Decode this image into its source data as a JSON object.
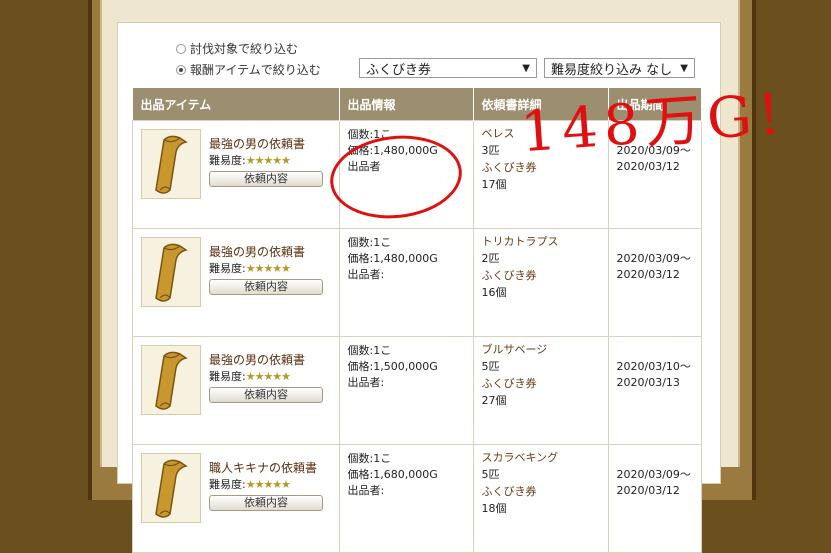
{
  "filters": {
    "radio_options": [
      {
        "label": "討伐対象で絞り込む",
        "checked": false
      },
      {
        "label": "報酬アイテムで絞り込む",
        "checked": true
      }
    ],
    "select_item": "ふくびき券",
    "select_difficulty": "難易度絞り込み なし"
  },
  "table": {
    "headers": [
      "出品アイテム",
      "出品情報",
      "依頼書詳細",
      "出品期間"
    ],
    "detail_button": "依頼内容",
    "difficulty_label": "難易度:",
    "stars": "★★★★★",
    "rows": [
      {
        "item_name": "最強の男の依頼書",
        "info": [
          "個数:1こ",
          "価格:1,480,000G",
          "出品者"
        ],
        "req": {
          "monster": "ベレス",
          "count": "3匹",
          "reward": "ふくびき券",
          "reward_count": "17個"
        },
        "dates": [
          "2020/03/09～",
          "2020/03/12"
        ]
      },
      {
        "item_name": "最強の男の依頼書",
        "info": [
          "個数:1こ",
          "価格:1,480,000G",
          "出品者:"
        ],
        "req": {
          "monster": "トリカトラプス",
          "count": "2匹",
          "reward": "ふくびき券",
          "reward_count": "16個"
        },
        "dates": [
          "2020/03/09～",
          "2020/03/12"
        ]
      },
      {
        "item_name": "最強の男の依頼書",
        "info": [
          "個数:1こ",
          "価格:1,500,000G",
          "出品者:"
        ],
        "req": {
          "monster": "ブルサベージ",
          "count": "5匹",
          "reward": "ふくびき券",
          "reward_count": "27個"
        },
        "dates": [
          "2020/03/10～",
          "2020/03/13"
        ]
      },
      {
        "item_name": "職人キキナの依頼書",
        "info": [
          "個数:1こ",
          "価格:1,680,000G",
          "出品者:"
        ],
        "req": {
          "monster": "スカラベキング",
          "count": "5匹",
          "reward": "ふくびき券",
          "reward_count": "18個"
        },
        "dates": [
          "2020/03/09～",
          "2020/03/12"
        ]
      }
    ]
  },
  "annotation": {
    "handwritten": "148万G!",
    "color": "#e01010"
  },
  "colors": {
    "header_bg": "#9c8f70",
    "item_name": "#5a2d0c",
    "stars": "#b49820"
  }
}
